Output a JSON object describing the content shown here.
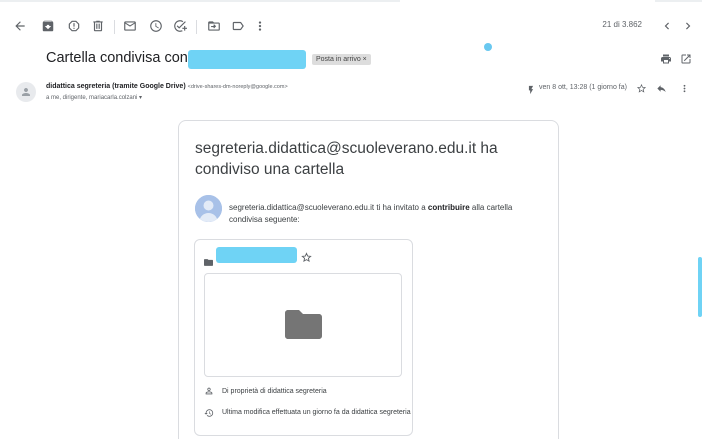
{
  "toolbar": {
    "counter": "21 di 3.862"
  },
  "message": {
    "subject": "Cartella condivisa con te: ‘",
    "label_chip": "Posta in arrivo ×",
    "sender_name": "didattica segreteria (tramite Google Drive)",
    "sender_email": "<drive-shares-dm-noreply@google.com>",
    "recipients": "a me, dirigente, mariacarla.colzani ▾",
    "date": "ven 8 ott, 13:28 (1 giorno fa)"
  },
  "card": {
    "title": "segreteria.didattica@scuoleverano.edu.it ha condiviso una cartella",
    "invite_prefix": "segreteria.didattica@scuoleverano.edu.it ti ha invitato a ",
    "invite_bold": "contribuire",
    "invite_suffix": " alla cartella condivisa seguente:",
    "owner": "Di proprietà di didattica segreteria",
    "modified": "Ultima modifica effettuata un giorno fa da didattica segreteria"
  },
  "icons": {
    "back": "arrow-left-icon",
    "archive": "archive-icon",
    "spam": "report-spam-icon",
    "delete": "trash-icon",
    "unread": "mail-icon",
    "snooze": "clock-icon",
    "task": "add-task-icon",
    "move": "move-to-folder-icon",
    "label": "label-icon",
    "more": "more-vert-icon",
    "prev": "chevron-left-icon",
    "next": "chevron-right-icon",
    "print": "print-icon",
    "open_new": "open-in-new-icon",
    "star": "star-outline-icon",
    "reply": "reply-icon",
    "person": "person-icon",
    "history": "history-icon",
    "folder": "folder-icon"
  },
  "colors": {
    "redaction": "#6fd3f5",
    "icon": "#5f6368",
    "text": "#202124"
  }
}
